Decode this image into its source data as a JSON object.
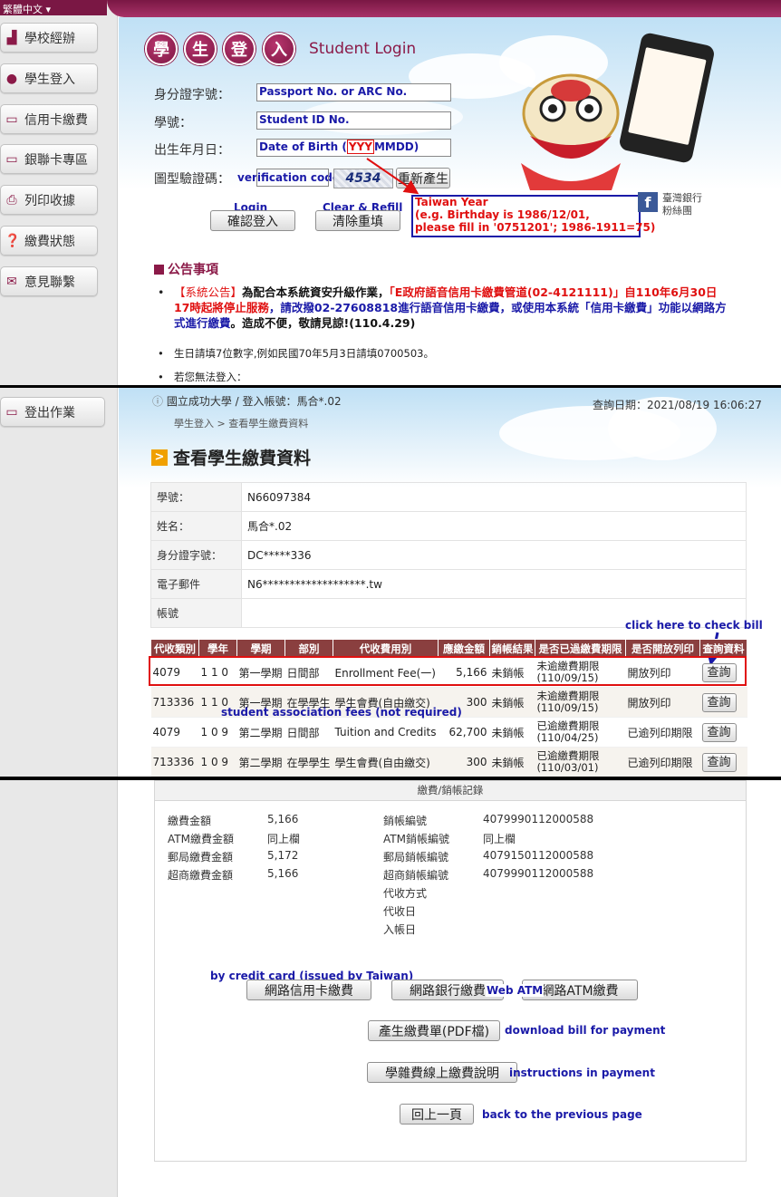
{
  "login": {
    "lang_selector": "繁體中文",
    "sidebar_items": [
      "學校經辦",
      "學生登入",
      "信用卡繳費",
      "銀聯卡專區",
      "列印收據",
      "繳費狀態",
      "意見聯繫"
    ],
    "title_chars": [
      "學",
      "生",
      "登",
      "入"
    ],
    "title_en": "Student Login",
    "fields": {
      "id_label": "身分證字號：",
      "id_placeholder": "Passport No. or ARC No.",
      "student_label": "學號：",
      "student_placeholder": "Student ID No.",
      "birth_label": "出生年月日：",
      "birth_placeholder_prefix": "Date of Birth (",
      "birth_placeholder_hl": "YYY",
      "birth_placeholder_suffix": "MMDD)",
      "captcha_label": "圖型驗證碼：",
      "captcha_placeholder": "verification code",
      "captcha_value": "4534",
      "regen_button": "重新產生"
    },
    "login_annot": "Login",
    "login_button": "確認登入",
    "clear_annot": "Clear & Refill",
    "clear_button": "清除重填",
    "taiwan_year_note": {
      "line1": "Taiwan Year",
      "line2": "(e.g. Birthday is 1986/12/01,",
      "line3": "please fill in '0751201'; 1986-1911=75)"
    },
    "fb_line1": "臺灣銀行",
    "fb_line2": "粉絲團",
    "bulletin_title": "公告事項",
    "notice1": {
      "prefix": "【系統公告】",
      "part1": "為配合本系統資安升級作業，",
      "part2": "「E政府語音信用卡繳費管道(02-4121111)」自",
      "part3": "110年6月30日",
      "part4": "17時起將停止服務",
      "part5": "，請改撥",
      "part6": "02-27608818",
      "part7": "進行語音信用卡繳費，或使用本系統「信用卡繳費」功能以網路方式進行繳費",
      "part8": "。造成不便，敬請見諒!",
      "part9": "(110.4.29)"
    },
    "notice2": "生日請填7位數字,例如民國70年5月3日請填0700503。",
    "notice3": "若您無法登入："
  },
  "bill": {
    "logout_button": "登出作業",
    "account_line": "國立成功大學 / 登入帳號：馬合*.02",
    "query_date": "查詢日期：2021/08/19 16:06:27",
    "breadcrumb": "學生登入 > 查看學生繳費資料",
    "heading": "查看學生繳費資料",
    "heading_icon": ">",
    "info_rows": [
      {
        "k": "學號：",
        "v": "N66097384"
      },
      {
        "k": "姓名：",
        "v": "馬合*.02"
      },
      {
        "k": "身分證字號：",
        "v": "DC*****336"
      },
      {
        "k": "電子郵件",
        "v": "N6*******************.tw"
      },
      {
        "k": "帳號",
        "v": ""
      }
    ],
    "click_annot": "click here to check bill",
    "columns": [
      "代收類別",
      "學年",
      "學期",
      "部別",
      "代收費用別",
      "應繳金額",
      "銷帳結果",
      "是否已過繳費期限",
      "是否開放列印",
      "查詢資料"
    ],
    "rows": [
      {
        "cat": "4079",
        "year": "1 1 0",
        "term": "第一學期",
        "dept": "日間部",
        "fee": "Enrollment Fee(一)",
        "amount": "5,166",
        "result": "未銷帳",
        "deadline1": "未逾繳費期限",
        "deadline2": "(110/09/15)",
        "print": "開放列印",
        "query": "查詢"
      },
      {
        "cat": "713336",
        "year": "1 1 0",
        "term": "第一學期",
        "dept": "在學學生",
        "fee": "學生會費(自由繳交)",
        "amount": "300",
        "result": "未銷帳",
        "deadline1": "未逾繳費期限",
        "deadline2": "(110/09/15)",
        "print": "開放列印",
        "query": "查詢"
      },
      {
        "cat": "4079",
        "year": "1 0 9",
        "term": "第二學期",
        "dept": "日間部",
        "fee": "Tuition and Credits",
        "amount": "62,700",
        "result": "未銷帳",
        "deadline1": "已逾繳費期限",
        "deadline2": "(110/04/25)",
        "print": "已逾列印期限",
        "query": "查詢"
      },
      {
        "cat": "713336",
        "year": "1 0 9",
        "term": "第二學期",
        "dept": "在學學生",
        "fee": "學生會費(自由繳交)",
        "amount": "300",
        "result": "未銷帳",
        "deadline1": "已逾繳費期限",
        "deadline2": "(110/03/01)",
        "print": "已逾列印期限",
        "query": "查詢"
      }
    ],
    "assoc_annot": "student association fees (not required)"
  },
  "record": {
    "heading": "繳費/銷帳記錄",
    "left": [
      {
        "k": "繳費金額",
        "v": "5,166"
      },
      {
        "k": "ATM繳費金額",
        "v": "同上欄"
      },
      {
        "k": "郵局繳費金額",
        "v": "5,172"
      },
      {
        "k": "超商繳費金額",
        "v": "5,166"
      }
    ],
    "right": [
      {
        "k": "銷帳編號",
        "v": "4079990112000588"
      },
      {
        "k": "ATM銷帳編號",
        "v": "同上欄"
      },
      {
        "k": "郵局銷帳編號",
        "v": "4079150112000588"
      },
      {
        "k": "超商銷帳編號",
        "v": "4079990112000588"
      },
      {
        "k": "代收方式",
        "v": ""
      },
      {
        "k": "代收日",
        "v": ""
      },
      {
        "k": "入帳日",
        "v": ""
      }
    ],
    "credit_annot": "by credit card (issued by Taiwan)",
    "credit_button": "網路信用卡繳費",
    "bank_button": "網路銀行繳費",
    "webatm_annot": "Web ATM",
    "atm_button": "網路ATM繳費",
    "pdf_button": "產生繳費單(PDF檔)",
    "pdf_annot": "download bill for payment",
    "instructions_button": "學雜費線上繳費說明",
    "instructions_annot": "instructions in payment",
    "back_button": "回上一頁",
    "back_annot": "back to the previous page"
  },
  "colors": {
    "brand": "#8b1a48",
    "annotation_blue": "#1a1aa8",
    "annotation_red": "#e01010",
    "table_header": "#8a3f3f"
  }
}
